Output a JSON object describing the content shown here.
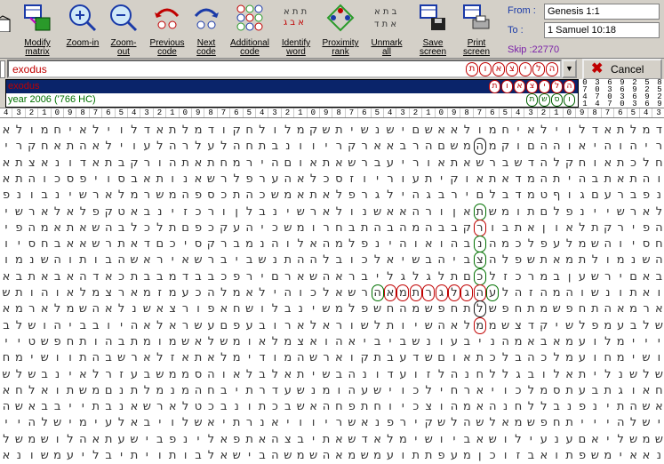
{
  "toolbar": {
    "buttons": [
      {
        "label": "",
        "icon": "book-icon"
      },
      {
        "label": "Modify matrix",
        "icon": "matrix-icon"
      },
      {
        "label": "Zoom-in",
        "icon": "zoom-in-icon"
      },
      {
        "label": "Zoom-out",
        "icon": "zoom-out-icon"
      },
      {
        "label": "Previous code",
        "icon": "previous-code-icon"
      },
      {
        "label": "Next code",
        "icon": "next-code-icon"
      },
      {
        "label": "Additional code",
        "icon": "additional-code-icon"
      },
      {
        "label": "Identify word",
        "icon": "identify-word-icon"
      },
      {
        "label": "Proximity rank",
        "icon": "proximity-rank-icon"
      },
      {
        "label": "Unmark all",
        "icon": "unmark-all-icon"
      },
      {
        "label": "Save screen",
        "icon": "save-icon"
      },
      {
        "label": "Print screen",
        "icon": "print-icon"
      }
    ],
    "from_label": "From :",
    "from_value": "Genesis 1:1",
    "to_label": "To :",
    "to_value": "1 Samuel 10:18",
    "skip": "Skip :22770"
  },
  "search": {
    "value": "exodus",
    "hebrew_letters": [
      "ת",
      "ו",
      "א",
      "צ",
      "י",
      "ל",
      "ה"
    ],
    "cancel_label": "Cancel",
    "dropdown": [
      {
        "text": "exodus",
        "letters": [
          "ת",
          "ו",
          "א",
          "צ",
          "י",
          "ל",
          "ה"
        ],
        "selected": true
      },
      {
        "text": "year 2006 ('766 HC)",
        "letters": [
          "ת",
          "ש",
          "ס",
          "ו"
        ],
        "selected": false
      }
    ]
  },
  "grid": {
    "rows": [
      "אלומחיאליולדאתלמדוקחלולמקשתישנשיםשא",
      "ירקחאתהאליועלהרלעלהחתבנווירקראאברהםשמהמקוםההואיהוהירא",
      "אתצאנודאתבקרוהתאתחמריהםואתאשרבעירואתאשרבשדהלקחואתכלחי",
      "אתהוכספיוסבאתונאשרלפרעהאלכסזוירועתיקואתאדמהתיהבת",
      "פנובנישראלמרשמהפסכתהכשמאתאלפרגליהגבריםלבדמטףוגםערב",
      "ישראלאלפקטאבניזכרוןלבנישראלונשאאהרוןאתשמותםלפני",
      "יפהמאתאשהבלכלתםפכקעהיכשמורחבתהבהמהבבקרובתאןואלתקר",
      "ויסחבאאשרתאדםכיסקרבמנהולאהמלפניהואוהבנהמכלפעלמשה",
      "ומנשהותובהשאריאשרביבשנתההלבוכלאישבהיבצהלפשתאמתל",
      "אבתאבאהדאכתבבמדבבכפריםראשהארבילגלגלתםכלזכרמבןעשרים",
      "שתוהואלמצראמזמעכהלמאליהוכלאשרהאמתרגלגהעלהזהמהושנותאו",
      "אמראלמשהאלנשאצרופאחשולבנישמלפשחהמשפחתלשפחתמשפחתה",
      "בלשוהיבבויהאלארשעםפעבוראלארושלתוישהאלממשצדקישלפמע",
      "ייטשפחתוהבתמומשאלשמואלמצאוהאיביבשנועבינהמאבאמעולמי",
      "חמישוותהבשראלזאתאלמידומהשראוקתבעדשםואתכלבהכלמעו",
      "שלשבניאלרזעבשממסהואלבלאתישבהנודעוזלהנחללגבולאתילנ",
      "אחלאותשמםנתלמנמהחביתרדעשנמוהעשיוכליחראיוכלמסתעבתגו",
      "השאבבייתבנאשראלטכבנותכבשאהחפתחויכצוהמאהנחללבנפנית",
      "ייהלשימיעלאביולשאיתרנאיווירשאנפריקשלהשלאמשפחתי",
      "לשמשולהאתעשיבפנילאפתאהצביתאשדאלמישויבאשוליענעםאי",
      "אנושמעילביתיותובלאשיבהשמשהאמשמעותתפעמןכוזבאותפשמיא"
    ]
  }
}
